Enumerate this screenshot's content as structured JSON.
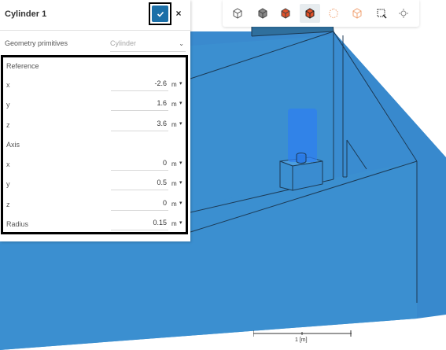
{
  "panel": {
    "title": "Cylinder 1",
    "geometry_label": "Geometry primitives",
    "geometry_value": "Cylinder",
    "reference_label": "Reference",
    "axis_label": "Axis",
    "reference": [
      {
        "label": "x",
        "value": "-2.6",
        "unit": "m"
      },
      {
        "label": "y",
        "value": "1.6",
        "unit": "m"
      },
      {
        "label": "z",
        "value": "3.6",
        "unit": "m"
      }
    ],
    "axis": [
      {
        "label": "x",
        "value": "0",
        "unit": "m"
      },
      {
        "label": "y",
        "value": "0.5",
        "unit": "m"
      },
      {
        "label": "z",
        "value": "0",
        "unit": "m"
      }
    ],
    "radius": {
      "label": "Radius",
      "value": "0.15",
      "unit": "m"
    }
  },
  "toolbar": {
    "icons": [
      "cube-outline-icon",
      "cube-solid-icon",
      "cube-red-faces-icon",
      "cube-red-selected-icon",
      "cube-dotted-icon",
      "cube-orange-outline-icon",
      "box-select-icon",
      "settings-icon"
    ]
  },
  "scale": {
    "label": "1 [m]"
  },
  "colors": {
    "model_blue": "#3b8fd0",
    "accent": "#1b6fa8",
    "highlight": "#000000"
  }
}
